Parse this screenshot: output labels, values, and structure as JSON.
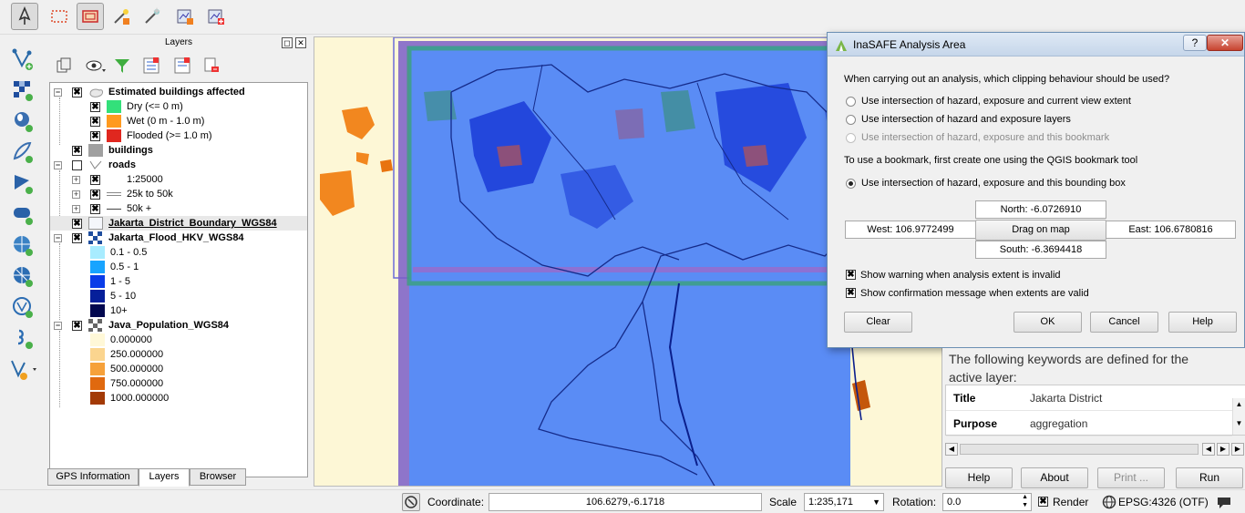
{
  "toolbar": {
    "icons": [
      "pan-map-icon",
      "select-features-icon",
      "set-extent-icon",
      "inasafe-wizard-icon",
      "inasafe-magic-icon",
      "inasafe-report-icon",
      "inasafe-add-layer-icon"
    ]
  },
  "left_toolbar": {
    "icons": [
      "add-vector-layer-icon",
      "add-raster-layer-icon",
      "add-postgis-layer-icon",
      "add-spatialite-layer-icon",
      "add-mssql-layer-icon",
      "add-oracle-layer-icon",
      "add-wms-layer-icon",
      "add-wcs-layer-icon",
      "add-wfs-layer-icon",
      "add-delimited-text-icon",
      "new-shapefile-icon"
    ]
  },
  "layers_panel": {
    "title": "Layers",
    "tabs": [
      "GPS Information",
      "Layers",
      "Browser"
    ],
    "active_tab": "Layers",
    "tree": [
      {
        "label": "Estimated buildings affected",
        "bold": true,
        "checked": true,
        "expander": "−"
      },
      {
        "label": "Dry (<= 0 m)",
        "checked": true,
        "color": "#33e07a"
      },
      {
        "label": "Wet (0 m - 1.0 m)",
        "checked": true,
        "color": "#ff9a1f"
      },
      {
        "label": "Flooded (>= 1.0 m)",
        "checked": true,
        "color": "#e0271f"
      },
      {
        "label": "buildings",
        "bold": true,
        "checked": true,
        "color": "#a0a0a0"
      },
      {
        "label": "roads",
        "bold": true,
        "checked": false,
        "expander": "−"
      },
      {
        "label": "1:25000",
        "checked": true,
        "expander": "+"
      },
      {
        "label": "25k to 50k",
        "checked": true,
        "expander": "+"
      },
      {
        "label": "50k +",
        "checked": true,
        "expander": "+"
      },
      {
        "label": "Jakarta_District_Boundary_WGS84",
        "bold": true,
        "checked": true,
        "selected": true
      },
      {
        "label": "Jakarta_Flood_HKV_WGS84",
        "bold": true,
        "checked": true,
        "expander": "−"
      },
      {
        "label": "0.1 - 0.5",
        "color": "#a8ecff"
      },
      {
        "label": "0.5 - 1",
        "color": "#18a4ff"
      },
      {
        "label": "1 - 5",
        "color": "#0a3ce8"
      },
      {
        "label": "5 - 10",
        "color": "#061f9a"
      },
      {
        "label": "10+",
        "color": "#02084f"
      },
      {
        "label": "Java_Population_WGS84",
        "bold": true,
        "checked": true,
        "expander": "−"
      },
      {
        "label": "0.000000",
        "color": "#fff8d8"
      },
      {
        "label": "250.000000",
        "color": "#fbd58f"
      },
      {
        "label": "500.000000",
        "color": "#f6a13a"
      },
      {
        "label": "750.000000",
        "color": "#e0690f"
      },
      {
        "label": "1000.000000",
        "color": "#a33a06"
      }
    ]
  },
  "dialog": {
    "title": "InaSAFE Analysis Area",
    "question": "When carrying out an analysis, which clipping behaviour should be used?",
    "options": [
      {
        "label": "Use intersection of hazard, exposure and current view extent",
        "selected": false,
        "enabled": true
      },
      {
        "label": "Use intersection of hazard and exposure layers",
        "selected": false,
        "enabled": true
      },
      {
        "label": "Use intersection of hazard, exposure and this bookmark",
        "selected": false,
        "enabled": false
      },
      {
        "label": "Use intersection of hazard, exposure and this bounding box",
        "selected": true,
        "enabled": true
      }
    ],
    "bookmark_note": "To use a bookmark, first create one using the QGIS bookmark tool",
    "north": "North: -6.0726910",
    "south": "South: -6.3694418",
    "west": "West: 106.9772499",
    "east": "East: 106.6780816",
    "drag_button": "Drag on map",
    "warn_check": "Show warning when analysis extent is invalid",
    "confirm_check": "Show confirmation message when extents are valid",
    "buttons": {
      "clear": "Clear",
      "ok": "OK",
      "cancel": "Cancel",
      "help": "Help"
    },
    "help_glyph": "?",
    "close_glyph": "✕"
  },
  "dock": {
    "text": "The following keywords are defined for the active layer:",
    "keywords": [
      {
        "key": "Title",
        "value": "Jakarta District"
      },
      {
        "key": "Purpose",
        "value": "aggregation"
      }
    ],
    "buttons": {
      "help": "Help",
      "about": "About",
      "print": "Print ...",
      "run": "Run"
    }
  },
  "statusbar": {
    "coordinate_label": "Coordinate:",
    "coordinate_value": "106.6279,-6.1718",
    "scale_label": "Scale",
    "scale_value": "1:235,171",
    "rotation_label": "Rotation:",
    "rotation_value": "0.0",
    "render_label": "Render",
    "render_checked": true,
    "crs": "EPSG:4326 (OTF)"
  },
  "colors": {
    "flood_blue": "#5a8cf5",
    "selection_purple": "#7a5ec8",
    "population_yellow": "#fdf7d6",
    "population_orange": "#f2871f"
  }
}
